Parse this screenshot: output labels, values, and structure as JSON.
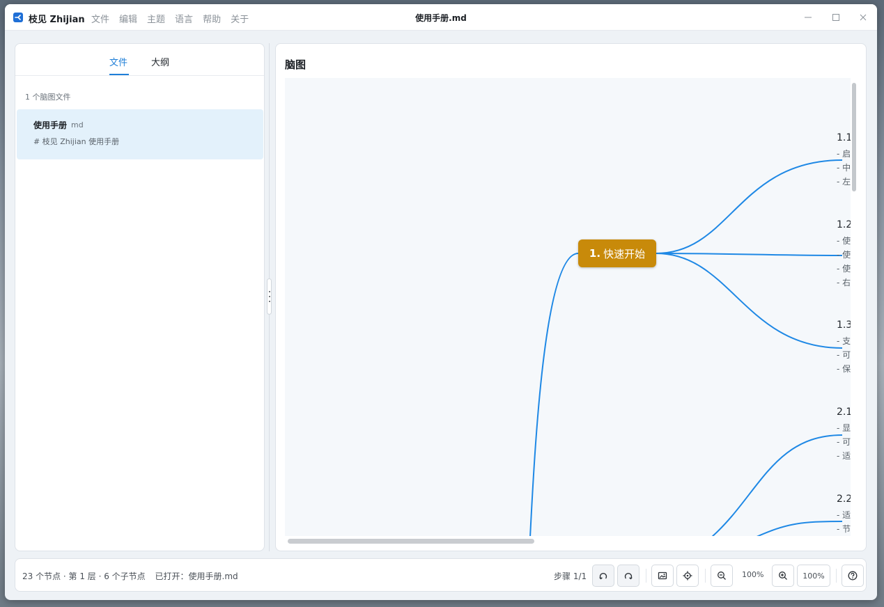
{
  "app": {
    "name": "枝见 Zhijian",
    "window_title": "使用手册.md",
    "menu": [
      "文件",
      "编辑",
      "主题",
      "语言",
      "帮助",
      "关于"
    ]
  },
  "sidebar": {
    "tabs": {
      "files": "文件",
      "outline": "大纲"
    },
    "file_count": "1 个脑图文件",
    "files": [
      {
        "name": "使用手册",
        "ext": "md",
        "preview": "# 枝见 Zhijian 使用手册"
      }
    ]
  },
  "main": {
    "title": "脑图",
    "root_node": {
      "number": "1.",
      "label": "快速开始"
    },
    "branches": [
      {
        "title": "1.1",
        "lines": [
          "- 启",
          "- 中",
          "- 左"
        ]
      },
      {
        "title": "1.2",
        "lines": [
          "- 使",
          "- 使",
          "- 使",
          "- 右"
        ]
      },
      {
        "title": "1.3",
        "lines": [
          "- 支",
          "- 可",
          "- 保"
        ]
      },
      {
        "title": "2.1",
        "lines": [
          "- 显",
          "- 可",
          "- 适"
        ]
      },
      {
        "title": "2.2",
        "lines": [
          "- 适",
          "- 节"
        ]
      }
    ]
  },
  "statusbar": {
    "node_count": "23 个节点 · 第 1 层 · 6 个子节点",
    "opened": "已打开：使用手册.md",
    "step": "步骤 1/1",
    "zoom_display": "100%",
    "zoom_reset": "100%"
  },
  "colors": {
    "accent": "#1f7fd8",
    "root_node": "#c88a0a",
    "edge": "#1e88e5",
    "selected_file": "#e3f1fb"
  },
  "icons": {
    "undo": "undo-icon",
    "redo": "redo-icon",
    "export_image": "image-icon",
    "locate": "crosshair-icon",
    "zoom_out": "zoom-out-icon",
    "zoom_in": "zoom-in-icon",
    "help": "help-icon"
  }
}
